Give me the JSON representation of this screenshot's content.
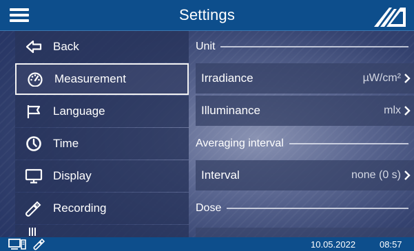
{
  "header": {
    "title": "Settings",
    "menu_icon": "hamburger-menu-icon",
    "logo_icon": "company-logo-icon"
  },
  "menu": {
    "items": [
      {
        "label": "Back",
        "icon": "back-arrow-icon"
      },
      {
        "label": "Measurement",
        "icon": "gauge-icon",
        "selected": true
      },
      {
        "label": "Language",
        "icon": "flag-icon"
      },
      {
        "label": "Time",
        "icon": "clock-icon"
      },
      {
        "label": "Display",
        "icon": "monitor-icon"
      },
      {
        "label": "Recording",
        "icon": "usb-stick-icon"
      }
    ]
  },
  "panel": {
    "unit_section": "Unit",
    "irradiance": {
      "label": "Irradiance",
      "value": "µW/cm²"
    },
    "illuminance": {
      "label": "Illuminance",
      "value": "mlx"
    },
    "averaging_section": "Averaging interval",
    "interval": {
      "label": "Interval",
      "value": "none (0 s)"
    },
    "dose_section": "Dose"
  },
  "status": {
    "date": "10.05.2022",
    "time": "08:57",
    "icons": [
      "pc-connection-icon",
      "usb-stick-icon"
    ]
  },
  "colors": {
    "header_bg": "#0d4e8c",
    "item_bg": "#28345c",
    "text": "#ffffff",
    "selected_border": "#f2f2f2"
  }
}
